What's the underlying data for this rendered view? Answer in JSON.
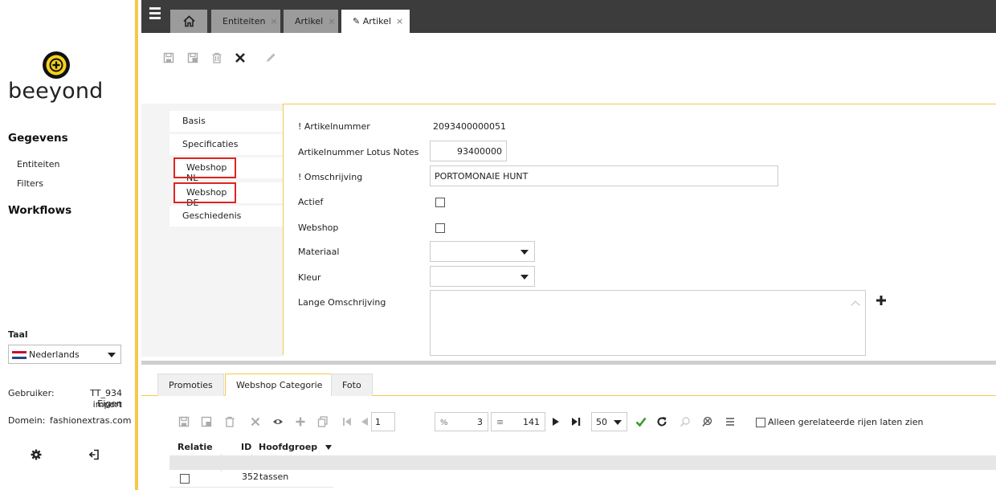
{
  "colors": {
    "accent": "#f5c84a",
    "topbar": "#3c3c3c",
    "highlight": "#e0231f",
    "check": "#3a9a2a"
  },
  "brand": {
    "logo_text": "beeyond"
  },
  "sidebar": {
    "section_data": "Gegevens",
    "items": [
      "Entiteiten",
      "Filters"
    ],
    "section_workflows": "Workflows",
    "language_label": "Taal",
    "language_value": "Nederlands",
    "user_label": "Gebruiker:",
    "user_value_line1": "TT_934 Eigen",
    "user_value_line2": "import",
    "domain_label": "Domein:",
    "domain_value": "fashionextras.com",
    "icons": [
      "gear-icon",
      "logout-icon"
    ]
  },
  "topbar": {
    "tabs": [
      {
        "label": "Entiteiten",
        "close": "×"
      },
      {
        "label": "Artikel",
        "close": "×"
      },
      {
        "label": "✎ Artikel",
        "close": "×"
      }
    ]
  },
  "toolbar": {
    "icons": [
      "save-icon",
      "save-as-icon",
      "delete-icon",
      "close-icon",
      "edit-icon"
    ]
  },
  "form_tabs": [
    "Basis",
    "Specificaties",
    "Webshop NL",
    "Webshop DE",
    "Geschiedenis"
  ],
  "form": {
    "artikelnummer_label": "! Artikelnummer",
    "artikelnummer_value": "2093400000051",
    "lotus_label": "Artikelnummer Lotus Notes",
    "lotus_value": "93400000",
    "omschrijving_label": "! Omschrijving",
    "omschrijving_value": "PORTOMONAIE HUNT",
    "actief_label": "Actief",
    "webshop_label": "Webshop",
    "materiaal_label": "Materiaal",
    "kleur_label": "Kleur",
    "lange_label": "Lange Omschrijving"
  },
  "bottom_tabs": [
    "Promoties",
    "Webshop Categorie",
    "Foto"
  ],
  "grid": {
    "page": "1",
    "percent_icon": "%",
    "selected_count": "3",
    "list_icon": "≡",
    "total": "141",
    "page_size": "50",
    "only_related_label": "Alleen gerelateerde rijen laten zien",
    "columns": [
      "Relatie",
      "ID",
      "Hoofdgroep"
    ],
    "rows": [
      {
        "id": "352",
        "hoofdgroep": "tassen"
      }
    ]
  }
}
